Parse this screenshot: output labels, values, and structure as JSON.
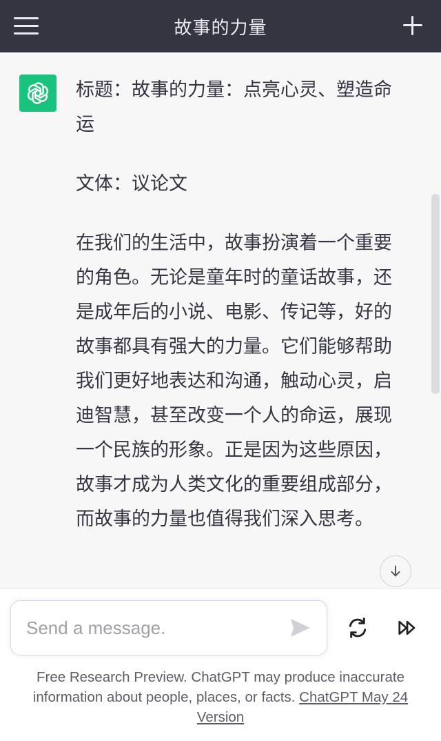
{
  "header": {
    "title": "故事的力量"
  },
  "message": {
    "paragraphs": [
      "标题：故事的力量：点亮心灵、塑造命运",
      "文体：议论文",
      "在我们的生活中，故事扮演着一个重要的角色。无论是童年时的童话故事，还是成年后的小说、电影、传记等，好的故事都具有强大的力量。它们能够帮助我们更好地表达和沟通，触动心灵，启迪智慧，甚至改变一个人的命运，展现一个民族的形象。正是因为这些原因，故事才成为人类文化的重要组成部分，而故事的力量也值得我们深入思考。"
    ]
  },
  "composer": {
    "placeholder": "Send a message."
  },
  "footer": {
    "text": "Free Research Preview. ChatGPT may produce inaccurate information about people, places, or facts.",
    "link": "ChatGPT May 24 Version"
  },
  "colors": {
    "header_bg": "#343541",
    "avatar_bg": "#19c37d",
    "chat_bg": "#f7f7f8"
  },
  "icons": {
    "menu": "menu-icon",
    "new_chat": "plus-icon",
    "avatar": "openai-logo-icon",
    "scroll_down": "arrow-down-icon",
    "send": "send-icon",
    "regenerate": "refresh-icon",
    "continue": "fast-forward-icon"
  }
}
